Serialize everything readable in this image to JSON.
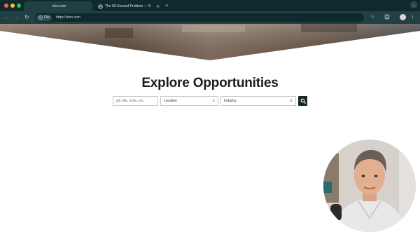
{
  "browser": {
    "tabs": [
      {
        "title": "zlsn.com",
        "active": true
      },
      {
        "title": "The 60-Second Problem — S",
        "active": false
      }
    ],
    "new_tab_label": "+",
    "omnibox": {
      "chip_label": "File",
      "url": "https://zlsn.com"
    }
  },
  "page": {
    "heading": "Explore Opportunities",
    "search": {
      "keyword_placeholder": "job title, skills, etc.",
      "location_label": "Location",
      "industry_label": "Industry"
    }
  },
  "icons": {
    "search": "search-icon",
    "bookmark": "star-icon",
    "extensions": "puzzle-icon",
    "menu": "kebab-menu-icon"
  },
  "colors": {
    "tabbar_bg": "#0f2a2c",
    "toolbar_bg": "#214043",
    "search_button": "#17262a",
    "heading_text": "#1c1c1c"
  }
}
